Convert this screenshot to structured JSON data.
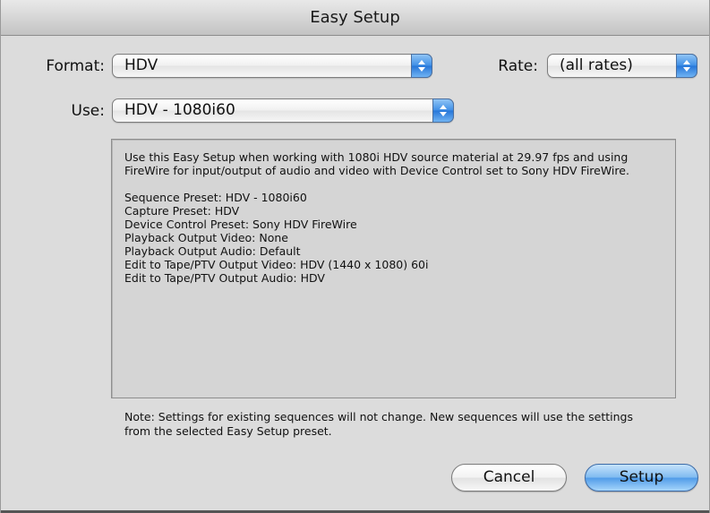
{
  "window": {
    "title": "Easy Setup"
  },
  "format": {
    "label": "Format:",
    "value": "HDV"
  },
  "rate": {
    "label": "Rate:",
    "value": "(all rates)"
  },
  "use": {
    "label": "Use:",
    "value": "HDV - 1080i60"
  },
  "description": {
    "intro": "Use this Easy Setup when working with 1080i HDV source material at 29.97 fps and using FireWire for input/output of audio and video with Device Control set to Sony HDV FireWire.",
    "lines": [
      "Sequence Preset: HDV - 1080i60",
      "Capture Preset: HDV",
      "Device Control Preset: Sony HDV FireWire",
      "Playback Output Video: None",
      "Playback Output Audio: Default",
      "Edit to Tape/PTV Output Video: HDV (1440 x 1080) 60i",
      "Edit to Tape/PTV Output Audio: HDV"
    ]
  },
  "note": "Note: Settings for existing sequences will not change. New sequences will use the settings from the selected Easy Setup preset.",
  "buttons": {
    "cancel": "Cancel",
    "setup": "Setup"
  },
  "icons": {
    "popup_arrows": "updown-arrows-icon"
  }
}
